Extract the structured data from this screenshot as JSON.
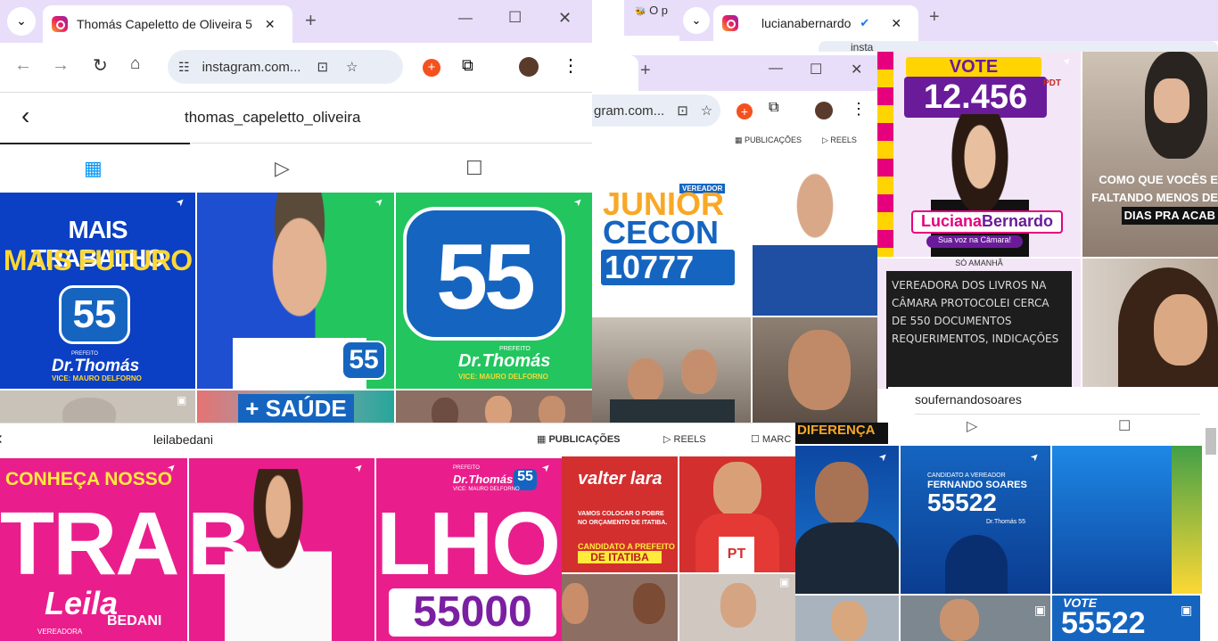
{
  "win1": {
    "tab_title": "Thomás Capeletto de Oliveira 5",
    "url": "instagram.com...",
    "profile": "thomas_capeletto_oliveira",
    "p1": {
      "l1": "MAIS TRABALHO",
      "l2": "MAIS FUTURO",
      "num": "55",
      "name": "Dr.Thomás",
      "sub": "PREFEITO",
      "vice": "VICE: MAURO DELFORNO"
    },
    "p2": {
      "num": "55"
    },
    "p3": {
      "num": "55",
      "pref": "PREFEITO",
      "name": "Dr.Thomás",
      "vice": "VICE: MAURO DELFORNO"
    },
    "p5": "+ SAÚDE"
  },
  "bg_tabs": {
    "t1": "O p",
    "t2": "lucianabernardo",
    "url2": "insta"
  },
  "win2": {
    "url": "gram.com...",
    "publicacoes": "PUBLICAÇÕES",
    "reels": "REELS",
    "post": {
      "role": "VEREADOR",
      "l1": "JUNIOR",
      "l2": "CECON",
      "num": "10777"
    },
    "post3": "DIFERENÇA"
  },
  "luciana": {
    "vote": "VOTE",
    "num": "12.456",
    "party": "PDT",
    "name1": "Luciana",
    "name2": "Bernardo",
    "slogan": "Sua voz na Câmara!",
    "quote1": "COMO QUE VOCÊS E",
    "quote2": "FALTANDO MENOS DE",
    "quote3": "DIAS PRA ACAB",
    "board_top": "SÓ AMANHÃ",
    "board": "VEREADORA DOS LIVROS NA CÂMARA PROTOCOLEI CERCA DE 550 DOCUMENTOS REQUERIMENTOS, INDICAÇÕES"
  },
  "leila": {
    "profile": "leilabedani",
    "l1": "CONHEÇA NOSSO",
    "big": "TRABALHO",
    "name": "Leila",
    "surname": "BEDANI",
    "role": "VEREADORA",
    "num": "55000",
    "pref": "PREFEITO",
    "dr": "Dr.Thomás",
    "vice": "VICE: MAURO DELFORNO",
    "num55": "55"
  },
  "valter": {
    "publicacoes": "PUBLICAÇÕES",
    "reels": "REELS",
    "marcados": "MARC",
    "name": "valter lara",
    "line1": "VAMOS COLOCAR O POBRE",
    "line2": "NO ORÇAMENTO DE ITATIBA.",
    "cand": "CANDIDATO A PREFEITO",
    "city": "DE ITATIBA",
    "pt": "PT"
  },
  "fernando": {
    "profile": "soufernandosoares",
    "cand": "CANDIDATO A VEREADOR",
    "name": "FERNANDO SOARES",
    "num": "55522",
    "dr": "Dr.Thomás 55",
    "vote": "VOTE",
    "num2": "55522"
  }
}
